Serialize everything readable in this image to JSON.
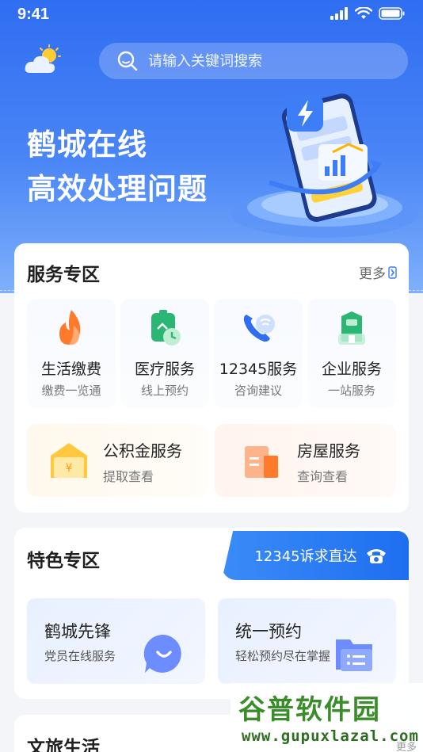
{
  "status": {
    "time": "9:41"
  },
  "search": {
    "placeholder": "请输入关键词搜索"
  },
  "hero": {
    "line1": "鹤城在线",
    "line2": "高效处理问题"
  },
  "services": {
    "title": "服务专区",
    "more": "更多",
    "items": [
      {
        "title": "生活缴费",
        "sub": "缴费一览通",
        "icon": "flame-icon"
      },
      {
        "title": "医疗服务",
        "sub": "线上预约",
        "icon": "medical-clock-icon"
      },
      {
        "title": "12345服务",
        "sub": "咨询建议",
        "icon": "phone-call-icon"
      },
      {
        "title": "企业服务",
        "sub": "一站服务",
        "icon": "building-icon"
      }
    ],
    "wide": [
      {
        "title": "公积金服务",
        "sub": "提取查看",
        "icon": "yuan-envelope-icon"
      },
      {
        "title": "房屋服务",
        "sub": "查询查看",
        "icon": "house-building-icon"
      }
    ]
  },
  "featured": {
    "title": "特色专区",
    "hotline": "12345诉求直达",
    "items": [
      {
        "title": "鹤城先锋",
        "sub": "党员在线服务",
        "icon": "chat-bubble-icon"
      },
      {
        "title": "统一预约",
        "sub": "轻松预约尽在掌握",
        "icon": "folder-icon"
      }
    ]
  },
  "culture": {
    "title": "文旅生活",
    "more": "更多"
  },
  "watermark": {
    "main": "谷普软件园",
    "url": "www.gupuxlazal.com"
  },
  "colors": {
    "primary": "#2f6df2",
    "accent_orange": "#ff7a2a",
    "accent_green": "#2bb673"
  }
}
